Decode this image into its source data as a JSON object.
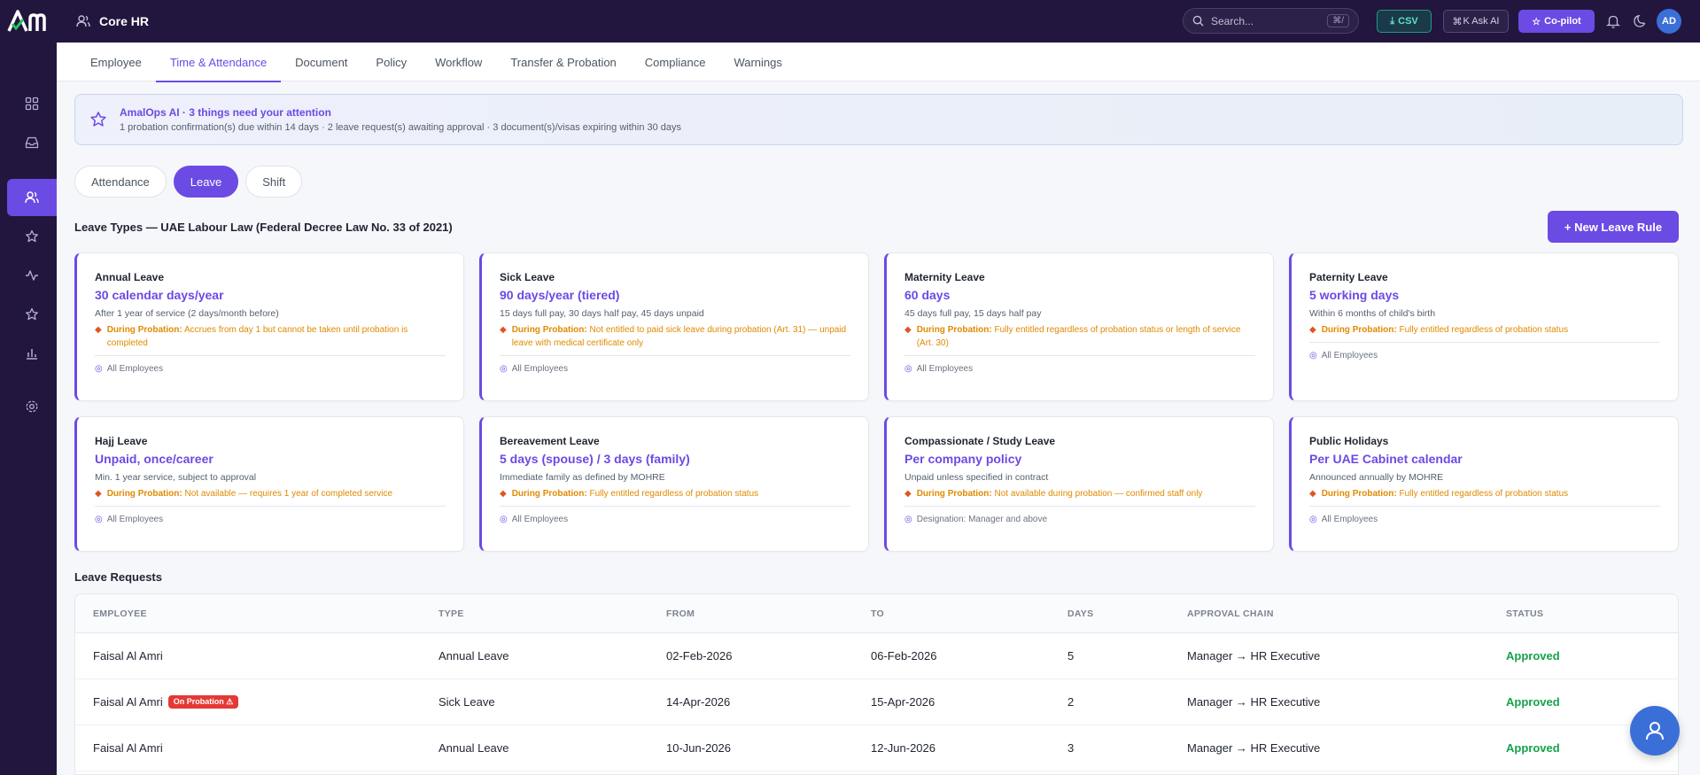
{
  "header": {
    "logo_text": "Am",
    "app_title": "Core HR",
    "search_placeholder": "Search...",
    "search_shortcut": "⌘/",
    "csv_label": "CSV",
    "ask_ai_label": "K Ask AI",
    "copilot_label": "Co-pilot",
    "avatar_initials": "AD"
  },
  "tabs": [
    {
      "label": "Employee"
    },
    {
      "label": "Time & Attendance"
    },
    {
      "label": "Document"
    },
    {
      "label": "Policy"
    },
    {
      "label": "Workflow"
    },
    {
      "label": "Transfer & Probation"
    },
    {
      "label": "Compliance"
    },
    {
      "label": "Warnings"
    }
  ],
  "banner": {
    "title": "AmalOps AI · 3 things need your attention",
    "description": "1 probation confirmation(s) due within 14 days · 2 leave request(s) awaiting approval · 3 document(s)/visas expiring within 30 days"
  },
  "pills": [
    {
      "label": "Attendance"
    },
    {
      "label": "Leave"
    },
    {
      "label": "Shift"
    }
  ],
  "leave_types": {
    "title": "Leave Types — UAE Labour Law (Federal Decree Law No. 33 of 2021)",
    "new_rule_label": "+ New Leave Rule",
    "probation_prefix": "During Probation:",
    "cards": [
      {
        "title": "Annual Leave",
        "value": "30 calendar days/year",
        "desc": "After 1 year of service (2 days/month before)",
        "probation": "Accrues from day 1 but cannot be taken until probation is completed",
        "scope": "All Employees"
      },
      {
        "title": "Sick Leave",
        "value": "90 days/year (tiered)",
        "desc": "15 days full pay, 30 days half pay, 45 days unpaid",
        "probation": "Not entitled to paid sick leave during probation (Art. 31) — unpaid leave with medical certificate only",
        "scope": "All Employees"
      },
      {
        "title": "Maternity Leave",
        "value": "60 days",
        "desc": "45 days full pay, 15 days half pay",
        "probation": "Fully entitled regardless of probation status or length of service (Art. 30)",
        "scope": "All Employees"
      },
      {
        "title": "Paternity Leave",
        "value": "5 working days",
        "desc": "Within 6 months of child's birth",
        "probation": "Fully entitled regardless of probation status",
        "scope": "All Employees"
      },
      {
        "title": "Hajj Leave",
        "value": "Unpaid, once/career",
        "desc": "Min. 1 year service, subject to approval",
        "probation": "Not available — requires 1 year of completed service",
        "scope": "All Employees"
      },
      {
        "title": "Bereavement Leave",
        "value": "5 days (spouse) / 3 days (family)",
        "desc": "Immediate family as defined by MOHRE",
        "probation": "Fully entitled regardless of probation status",
        "scope": "All Employees"
      },
      {
        "title": "Compassionate / Study Leave",
        "value": "Per company policy",
        "desc": "Unpaid unless specified in contract",
        "probation": "Not available during probation — confirmed staff only",
        "scope": "Designation: Manager and above"
      },
      {
        "title": "Public Holidays",
        "value": "Per UAE Cabinet calendar",
        "desc": "Announced annually by MOHRE",
        "probation": "Fully entitled regardless of probation status",
        "scope": "All Employees"
      }
    ]
  },
  "leave_requests": {
    "title": "Leave Requests",
    "columns": [
      "EMPLOYEE",
      "TYPE",
      "FROM",
      "TO",
      "DAYS",
      "APPROVAL CHAIN",
      "STATUS"
    ],
    "probation_badge": "On Probation ⚠",
    "rows": [
      {
        "employee": "Faisal Al Amri",
        "on_probation": false,
        "type": "Annual Leave",
        "from": "02-Feb-2026",
        "to": "06-Feb-2026",
        "days": "5",
        "chain": "Manager → HR Executive",
        "status": "Approved"
      },
      {
        "employee": "Faisal Al Amri",
        "on_probation": true,
        "type": "Sick Leave",
        "from": "14-Apr-2026",
        "to": "15-Apr-2026",
        "days": "2",
        "chain": "Manager → HR Executive",
        "status": "Approved"
      },
      {
        "employee": "Faisal Al Amri",
        "on_probation": false,
        "type": "Annual Leave",
        "from": "10-Jun-2026",
        "to": "12-Jun-2026",
        "days": "3",
        "chain": "Manager → HR Executive",
        "status": "Approved"
      }
    ]
  },
  "colors": {
    "accent": "#6c4ae4",
    "sidebar": "#22163e",
    "success": "#16a34a",
    "warning": "#e08a00",
    "danger": "#e53935"
  }
}
